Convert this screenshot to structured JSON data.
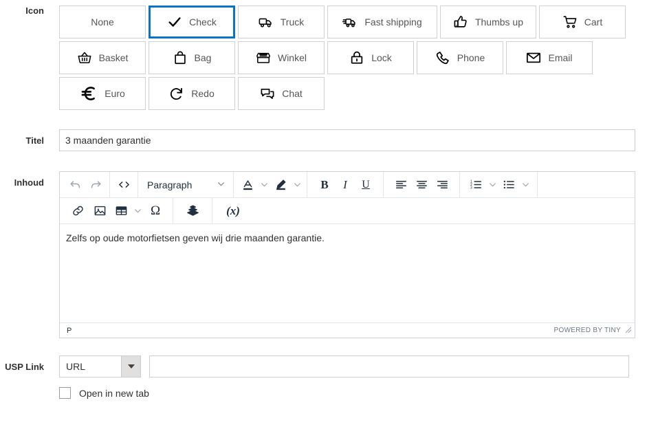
{
  "form": {
    "icon_field": {
      "label": "Icon",
      "options": [
        {
          "label": "None",
          "icon": "none",
          "selected": false,
          "width": "w126"
        },
        {
          "label": "Check",
          "icon": "check-icon",
          "selected": true,
          "width": "w126"
        },
        {
          "label": "Truck",
          "icon": "truck-icon",
          "selected": false,
          "width": "w126"
        },
        {
          "label": "Fast shipping",
          "icon": "fast-shipping-icon",
          "selected": false,
          "width": "w160"
        },
        {
          "label": "Thumbs up",
          "icon": "thumbs-up-icon",
          "selected": false,
          "width": "w140"
        },
        {
          "label": "Cart",
          "icon": "cart-icon",
          "selected": false,
          "width": "w126"
        },
        {
          "label": "Basket",
          "icon": "basket-icon",
          "selected": false,
          "width": "w126"
        },
        {
          "label": "Bag",
          "icon": "bag-icon",
          "selected": false,
          "width": "w126"
        },
        {
          "label": "Winkel",
          "icon": "shop-icon",
          "selected": false,
          "width": "w126"
        },
        {
          "label": "Lock",
          "icon": "lock-icon",
          "selected": false,
          "width": "w126"
        },
        {
          "label": "Phone",
          "icon": "phone-icon",
          "selected": false,
          "width": "w126"
        },
        {
          "label": "Email",
          "icon": "email-icon",
          "selected": false,
          "width": "w126"
        },
        {
          "label": "Euro",
          "icon": "euro-icon",
          "selected": false,
          "width": "w126"
        },
        {
          "label": "Redo",
          "icon": "redo-icon",
          "selected": false,
          "width": "w126"
        },
        {
          "label": "Chat",
          "icon": "chat-icon",
          "selected": false,
          "width": "w126"
        }
      ],
      "selected_value": "Check",
      "accent_color": "#0a73c4"
    },
    "title_field": {
      "label": "Titel",
      "value": "3 maanden garantie",
      "placeholder": ""
    },
    "content_field": {
      "label": "Inhoud",
      "editor": {
        "toolbar_row1": {
          "undo_label": "Undo",
          "redo_label": "Redo",
          "source_code_label": "Source code",
          "block_format": "Paragraph",
          "text_color_label": "Text color",
          "background_color_label": "Background color",
          "bold_label": "Bold",
          "italic_label": "Italic",
          "underline_label": "Underline",
          "align_left_label": "Align left",
          "align_center_label": "Align center",
          "align_right_label": "Align right",
          "numbered_list_label": "Numbered list",
          "bullet_list_label": "Bullet list"
        },
        "toolbar_row2": {
          "link_label": "Insert/edit link",
          "image_label": "Insert/edit image",
          "table_label": "Table",
          "special_char_label": "Special character",
          "block_label": "Blocks",
          "variable_label": "Variables"
        },
        "body_text": "Zelfs op oude motorfietsen geven wij drie maanden garantie.",
        "status_path": "P",
        "status_branding": "POWERED BY TINY"
      }
    },
    "usp_link_field": {
      "label": "USP Link",
      "type_value": "URL",
      "url_value": "",
      "url_placeholder": "",
      "new_tab_label": "Open in new tab",
      "new_tab_checked": false
    }
  }
}
